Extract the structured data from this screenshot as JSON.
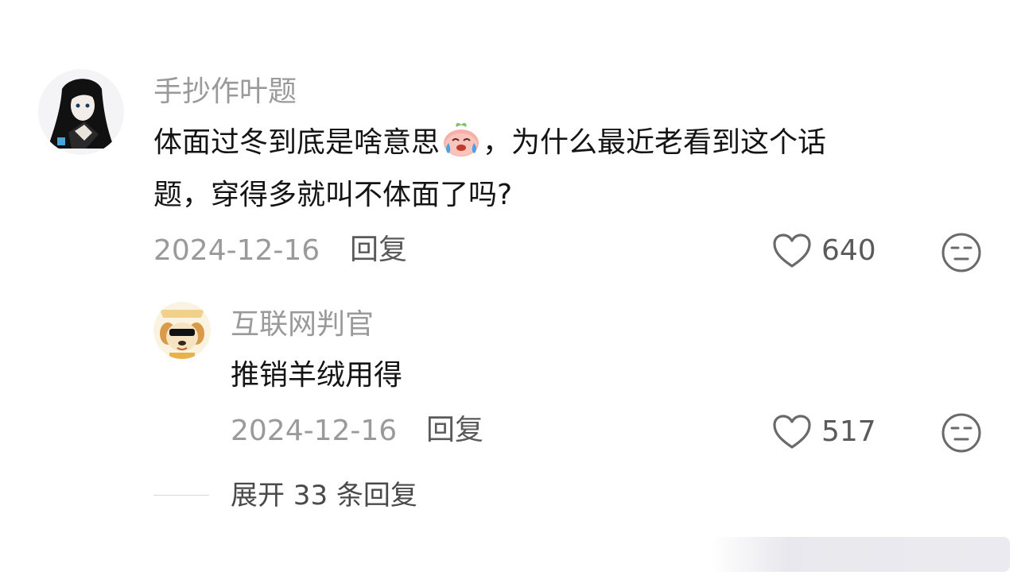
{
  "comments": [
    {
      "username": "手抄作叶题",
      "text_line1_before": "体面过冬到底是啥意思",
      "emoji_inline": "crying-laughing-peach-emoji",
      "text_line1_after": "，为什么最近老看到这个话",
      "text_line2": "题，穿得多就叫不体面了吗?",
      "date": "2024-12-16",
      "reply_label": "回复",
      "likes": "640"
    },
    {
      "username": "互联网判官",
      "text": "推销羊绒用得",
      "date": "2024-12-16",
      "reply_label": "回复",
      "likes": "517"
    }
  ],
  "expand_replies": "展开 33 条回复",
  "icons": {
    "like": "heart-outline-icon",
    "react": "neutral-face-icon"
  },
  "colors": {
    "username": "#9a9a9a",
    "text": "#141414",
    "meta": "#9a9a9a",
    "action": "#5a5a5a"
  }
}
